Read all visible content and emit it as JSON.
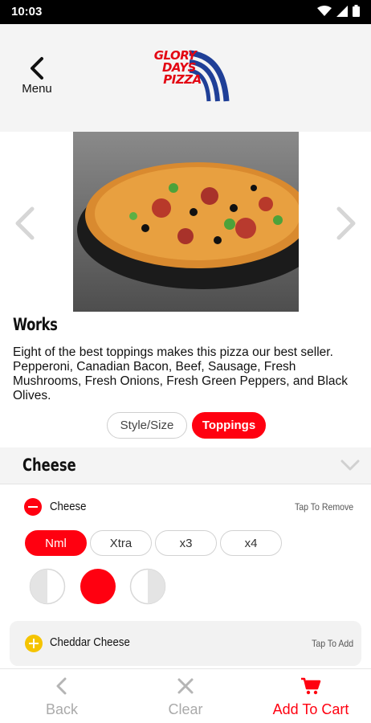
{
  "status_bar": {
    "time": "10:03",
    "icons": [
      "wifi-icon",
      "signal-icon",
      "battery-icon"
    ]
  },
  "header": {
    "back_label": "Menu",
    "logo_lines": [
      "GLORY",
      "DAYS",
      "PIZZA"
    ]
  },
  "product": {
    "title": "Works",
    "description": "Eight of the best toppings makes this pizza our best seller.  Pepperoni, Canadian Bacon, Beef, Sausage, Fresh Mushrooms, Fresh Onions, Fresh Green Peppers, and Black Olives."
  },
  "tabs": [
    {
      "label": "Style/Size",
      "active": false
    },
    {
      "label": "Toppings",
      "active": true
    }
  ],
  "section": {
    "title": "Cheese"
  },
  "toppings": [
    {
      "name": "Cheese",
      "hint": "Tap To Remove",
      "amounts": [
        "Nml",
        "Xtra",
        "x3",
        "x4"
      ],
      "selected_amount": "Nml",
      "portions": [
        "left-half",
        "whole",
        "right-half"
      ],
      "selected_portion": "whole"
    },
    {
      "name": "Cheddar Cheese",
      "hint": "Tap To Add"
    }
  ],
  "bottom_nav": {
    "back": "Back",
    "clear": "Clear",
    "add_to_cart": "Add To Cart"
  },
  "colors": {
    "accent": "#ff0010",
    "add_yellow": "#f5c400",
    "header_bg": "#f4f4f4",
    "inactive_gray": "#aaaaaa"
  }
}
